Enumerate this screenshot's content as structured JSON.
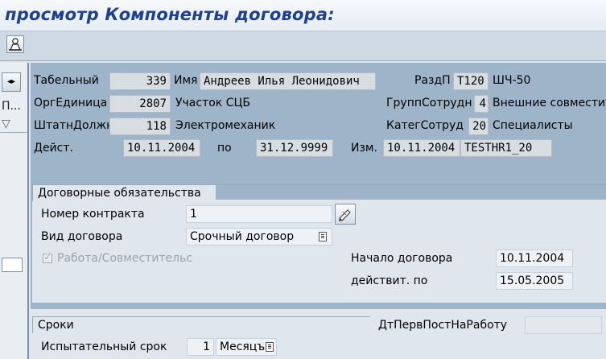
{
  "window": {
    "title": "просмотр Компоненты договора:"
  },
  "left_panel": {
    "item1": "П...",
    "item2": "▽"
  },
  "header": {
    "tabelny_label": "Табельный",
    "tabelny_value": "339",
    "name_label": "Имя",
    "name_value": "Андреев Илья Леонидович",
    "razdp_label": "РаздП",
    "razdp_code": "Т120",
    "razdp_text": "ШЧ-50",
    "org_label": "ОргЕдиница",
    "org_value": "2807",
    "org_text": "Участок СЦБ",
    "grupp_label": "ГруппСотрудн",
    "grupp_code": "4",
    "grupp_text": "Внешние совместит",
    "shtat_label": "ШтатнДолжн",
    "shtat_value": "118",
    "shtat_text": "Электромеханик",
    "kateg_label": "КатегСотруд",
    "kateg_code": "20",
    "kateg_text": "Специалисты",
    "deyst_label": "Дейст.",
    "deyst_from": "10.11.2004",
    "po_label": "по",
    "deyst_to": "31.12.9999",
    "izm_label": "Изм.",
    "izm_date": "10.11.2004",
    "izm_user": "TESTHR1_20"
  },
  "contract": {
    "tab_label": "Договорные обязательства",
    "nomer_label": "Номер контракта",
    "nomer_value": "1",
    "vid_label": "Вид договора",
    "vid_value": "Срочный договор",
    "sovm_label": "Работа/Совместительс",
    "sovm_checked": "✓",
    "nachalo_label": "Начало договора",
    "nachalo_value": "10.11.2004",
    "deystvit_label": "действит. по",
    "deystvit_value": "15.05.2005"
  },
  "sroki": {
    "tab_label": "Сроки",
    "isp_label": "Испытательный срок",
    "isp_value": "1",
    "isp_unit": "Месяцъ",
    "dt_label": "ДтПервПостНаРаботу",
    "dt_value": ""
  }
}
